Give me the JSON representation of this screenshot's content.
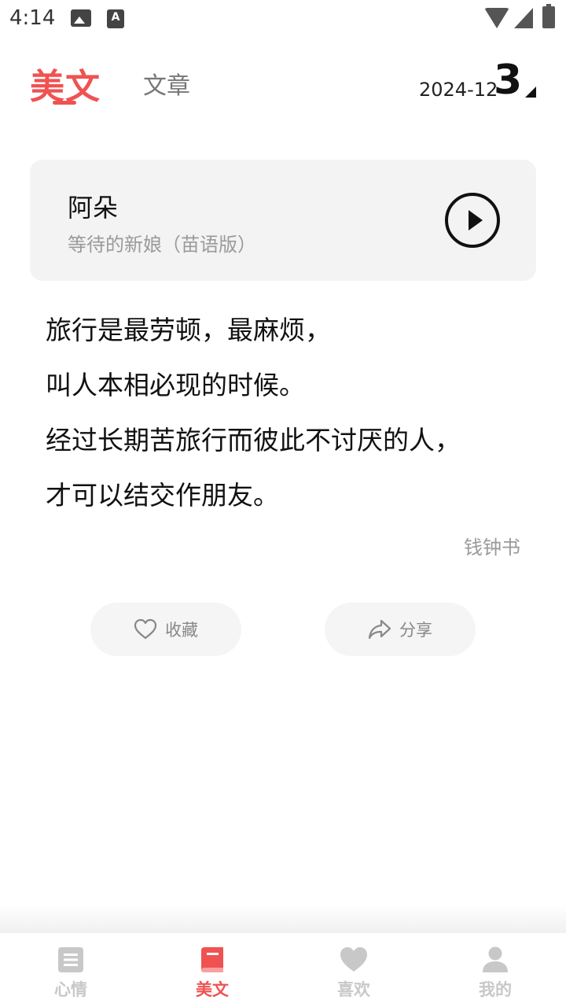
{
  "status_bar": {
    "time": "4:14"
  },
  "header": {
    "tab_active": "美文",
    "tab_inactive": "文章",
    "date_year_month": "2024-12",
    "date_day": "3"
  },
  "music": {
    "title": "阿朵",
    "subtitle": "等待的新娘（苗语版）"
  },
  "quote": {
    "lines": [
      "旅行是最劳顿，最麻烦，",
      "叫人本相必现的时候。",
      "经过长期苦旅行而彼此不讨厌的人，",
      "才可以结交作朋友。"
    ],
    "author": "钱钟书"
  },
  "actions": {
    "favorite_label": "收藏",
    "share_label": "分享"
  },
  "bottom_nav": {
    "items": [
      {
        "label": "心情",
        "icon": "document-icon"
      },
      {
        "label": "美文",
        "icon": "book-icon"
      },
      {
        "label": "喜欢",
        "icon": "heart-icon"
      },
      {
        "label": "我的",
        "icon": "person-icon"
      }
    ],
    "active_index": 1
  },
  "colors": {
    "accent": "#f05252",
    "inactive_nav": "#c8c8c8",
    "muted_text": "#999999",
    "card_bg": "#f3f3f3"
  }
}
